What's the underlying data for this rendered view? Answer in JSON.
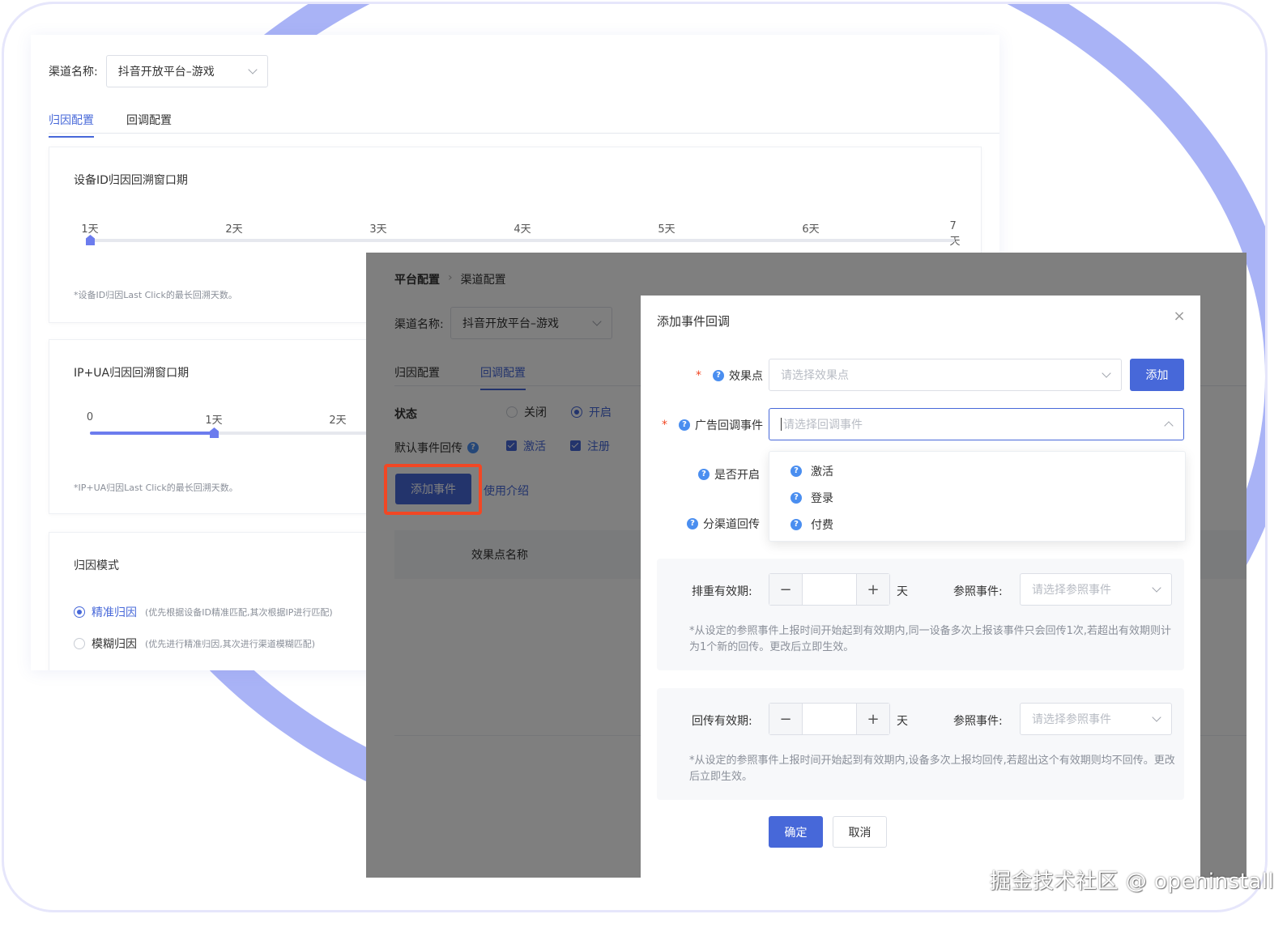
{
  "back": {
    "channel_label": "渠道名称:",
    "channel_value": "抖音开放平台–游戏",
    "tabs": [
      "归因配置",
      "回调配置"
    ],
    "device_card": {
      "title": "设备ID归因回溯窗口期",
      "ticks": [
        "1天",
        "2天",
        "3天",
        "4天",
        "5天",
        "6天",
        "7天"
      ],
      "note": "*设备ID归因Last Click的最长回溯天数。"
    },
    "ipua_card": {
      "title": "IP+UA归因回溯窗口期",
      "ticks": [
        "0",
        "1天",
        "2天"
      ],
      "note": "*IP+UA归因Last Click的最长回溯天数。"
    },
    "mode_card": {
      "title": "归因模式",
      "options": [
        {
          "label": "精准归因",
          "desc": "(优先根据设备ID精准匹配,其次根据IP进行匹配)"
        },
        {
          "label": "模糊归因",
          "desc": "(优先进行精准归因,其次进行渠道模糊匹配)"
        }
      ]
    }
  },
  "mid": {
    "breadcrumb": [
      "平台配置",
      "渠道配置"
    ],
    "channel_label": "渠道名称:",
    "channel_value": "抖音开放平台–游戏",
    "tabs": [
      "归因配置",
      "回调配置"
    ],
    "status_label": "状态",
    "status_off": "关闭",
    "status_on": "开启",
    "default_label": "默认事件回传",
    "default_events": [
      "激活",
      "注册"
    ],
    "add_event_button": "添加事件",
    "usage_link": "使用介绍",
    "table_header": "效果点名称"
  },
  "modal": {
    "title": "添加事件回调",
    "effect_label": "效果点",
    "effect_placeholder": "请选择效果点",
    "add_button": "添加",
    "ad_callback_label": "广告回调事件",
    "ad_callback_placeholder": "请选择回调事件",
    "enable_label": "是否开启",
    "subchannel_label": "分渠道回传",
    "dropdown_options": [
      "激活",
      "登录",
      "付费"
    ],
    "dedup_label": "排重有效期:",
    "callback_label": "回传有效期:",
    "day_unit": "天",
    "ref_label": "参照事件:",
    "ref_placeholder": "请选择参照事件",
    "dedup_hint": "*从设定的参照事件上报时间开始起到有效期内,同一设备多次上报该事件只会回传1次,若超出有效期则计为1个新的回传。更改后立即生效。",
    "callback_hint": "*从设定的参照事件上报时间开始起到有效期内,设备多次上报均回传,若超出这个有效期则均不回传。更改后立即生效。",
    "confirm_button": "确定",
    "cancel_button": "取消"
  },
  "watermark": "掘金技术社区 @ openinstall",
  "colors": {
    "primary": "#4768d9",
    "highlight": "#f24724",
    "arc": "#a9b3f6"
  }
}
